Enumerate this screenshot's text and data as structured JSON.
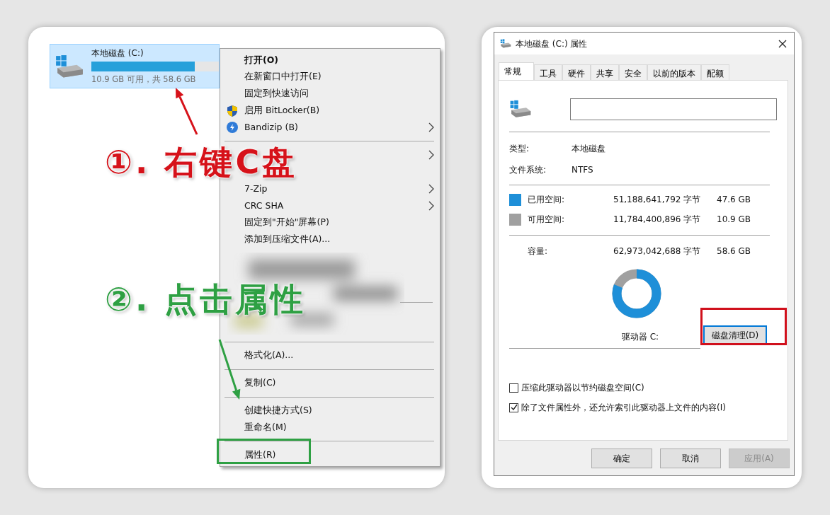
{
  "drive_tile": {
    "name": "本地磁盘 (C:)",
    "level": 0.81,
    "summary": "10.9 GB 可用，共 58.6 GB",
    "selected": true
  },
  "context_menu": {
    "items": [
      {
        "kind": "default",
        "text": "打开(O)",
        "submenu": false
      },
      {
        "kind": "item",
        "text": "在新窗口中打开(E)",
        "submenu": false
      },
      {
        "kind": "item",
        "text": "固定到快速访问",
        "submenu": false
      },
      {
        "kind": "shield",
        "text": "启用 BitLocker(B)",
        "submenu": false
      },
      {
        "kind": "bolt",
        "text": "Bandizip (B)",
        "submenu": true
      },
      {
        "kind": "separator"
      },
      {
        "kind": "covered",
        "submenu": true
      },
      {
        "kind": "covered",
        "submenu": false
      },
      {
        "kind": "item",
        "text": "7-Zip",
        "submenu": true
      },
      {
        "kind": "item",
        "text": "CRC SHA",
        "submenu": true
      },
      {
        "kind": "item",
        "text": "固定到\"开始\"屏幕(P)",
        "submenu": false
      },
      {
        "kind": "item",
        "text": "添加到压缩文件(A)...",
        "submenu": false
      },
      {
        "kind": "blurred"
      },
      {
        "kind": "separator"
      },
      {
        "kind": "item",
        "text": "格式化(A)...",
        "submenu": false
      },
      {
        "kind": "separator"
      },
      {
        "kind": "item",
        "text": "复制(C)",
        "submenu": false
      },
      {
        "kind": "separator"
      },
      {
        "kind": "item",
        "text": "创建快捷方式(S)",
        "submenu": false
      },
      {
        "kind": "item",
        "text": "重命名(M)",
        "submenu": false
      },
      {
        "kind": "separator"
      },
      {
        "kind": "item",
        "text": "属性(R)",
        "submenu": false
      }
    ]
  },
  "annotations": [
    {
      "text": "①. 右键C盘",
      "color": "#d6121a"
    },
    {
      "text": "②. 点击属性",
      "color": "#2ea043"
    }
  ],
  "properties_dialog": {
    "title": "本地磁盘 (C:) 属性",
    "tabs": [
      {
        "label": "常规",
        "selected": true
      },
      {
        "label": "工具",
        "selected": false
      },
      {
        "label": "硬件",
        "selected": false
      },
      {
        "label": "共享",
        "selected": false
      },
      {
        "label": "安全",
        "selected": false
      },
      {
        "label": "以前的版本",
        "selected": false
      },
      {
        "label": "配额",
        "selected": false
      }
    ],
    "type_label": "类型:",
    "type_value": "本地磁盘",
    "fs_label": "文件系统:",
    "fs_value": "NTFS",
    "space": [
      {
        "label": "已用空间:",
        "bytes": "51,188,641,792 字节",
        "size": "47.6 GB",
        "color": "#1e8fd8"
      },
      {
        "label": "可用空间:",
        "bytes": "11,784,400,896 字节",
        "size": "10.9 GB",
        "color": "#a0a0a0"
      }
    ],
    "capacity": {
      "label": "容量:",
      "bytes": "62,973,042,688 字节",
      "size": "58.6 GB"
    },
    "drive_label": "驱动器 C:",
    "cleanup_button": "磁盘清理(D)",
    "options": [
      {
        "label": "压缩此驱动器以节约磁盘空间(C)",
        "checked": false
      },
      {
        "label": "除了文件属性外，还允许索引此驱动器上文件的内容(I)",
        "checked": true
      }
    ],
    "buttons": [
      {
        "label": "确定",
        "disabled": false
      },
      {
        "label": "取消",
        "disabled": false
      },
      {
        "label": "应用(A)",
        "disabled": true
      }
    ]
  }
}
